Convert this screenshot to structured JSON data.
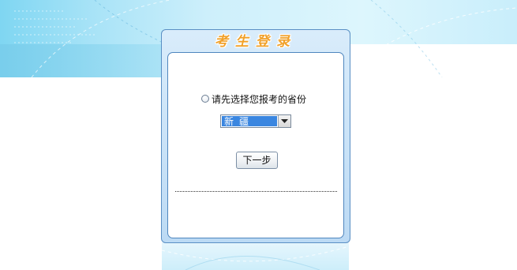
{
  "login": {
    "title": "考生登录",
    "prompt": "请先选择您报考的省份",
    "province_selected": "新疆",
    "next_label": "下一步"
  },
  "colors": {
    "title": "#f1a12a",
    "frame_border": "#5a8fc4",
    "select_highlight": "#3a86e0"
  }
}
